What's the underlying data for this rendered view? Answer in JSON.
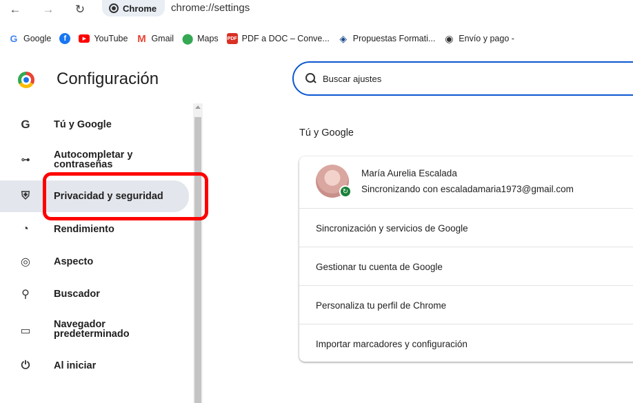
{
  "browser": {
    "chip_label": "Chrome",
    "url": "chrome://settings",
    "back_icon": "arrow-left-icon",
    "forward_icon": "arrow-right-icon",
    "reload_icon": "reload-icon"
  },
  "bookmarks": [
    {
      "label": "Google",
      "icon": "google-icon"
    },
    {
      "label": "",
      "icon": "facebook-icon"
    },
    {
      "label": "YouTube",
      "icon": "youtube-icon"
    },
    {
      "label": "Gmail",
      "icon": "gmail-icon"
    },
    {
      "label": "Maps",
      "icon": "maps-icon"
    },
    {
      "label": "PDF a DOC – Conve...",
      "icon": "pdf-icon"
    },
    {
      "label": "Propuestas Formati...",
      "icon": "government-icon"
    },
    {
      "label": "Envío y pago -",
      "icon": "globe-icon"
    }
  ],
  "header": {
    "title": "Configuración",
    "search_placeholder": "Buscar ajustes"
  },
  "sidebar": {
    "items": [
      {
        "label": "Tú y Google",
        "icon": "google-g-icon"
      },
      {
        "label": "Autocompletar y contraseñas",
        "icon": "key-icon"
      },
      {
        "label": "Privacidad y seguridad",
        "icon": "shield-icon",
        "active": true
      },
      {
        "label": "Rendimiento",
        "icon": "speedometer-icon"
      },
      {
        "label": "Aspecto",
        "icon": "palette-icon"
      },
      {
        "label": "Buscador",
        "icon": "search-icon"
      },
      {
        "label": "Navegador predeterminado",
        "icon": "browser-window-icon"
      },
      {
        "label": "Al iniciar",
        "icon": "power-icon"
      }
    ]
  },
  "section": {
    "title": "Tú y Google",
    "account_name": "María Aurelia Escalada",
    "account_status": "Sincronizando con escaladamaria1973@gmail.com",
    "rows": [
      "Sincronización y servicios de Google",
      "Gestionar tu cuenta de Google",
      "Personaliza tu perfil de Chrome",
      "Importar marcadores y configuración"
    ]
  },
  "colors": {
    "accent": "#0b57d0",
    "highlight_box": "#ff0000",
    "active_bg": "#e3e6ec"
  }
}
